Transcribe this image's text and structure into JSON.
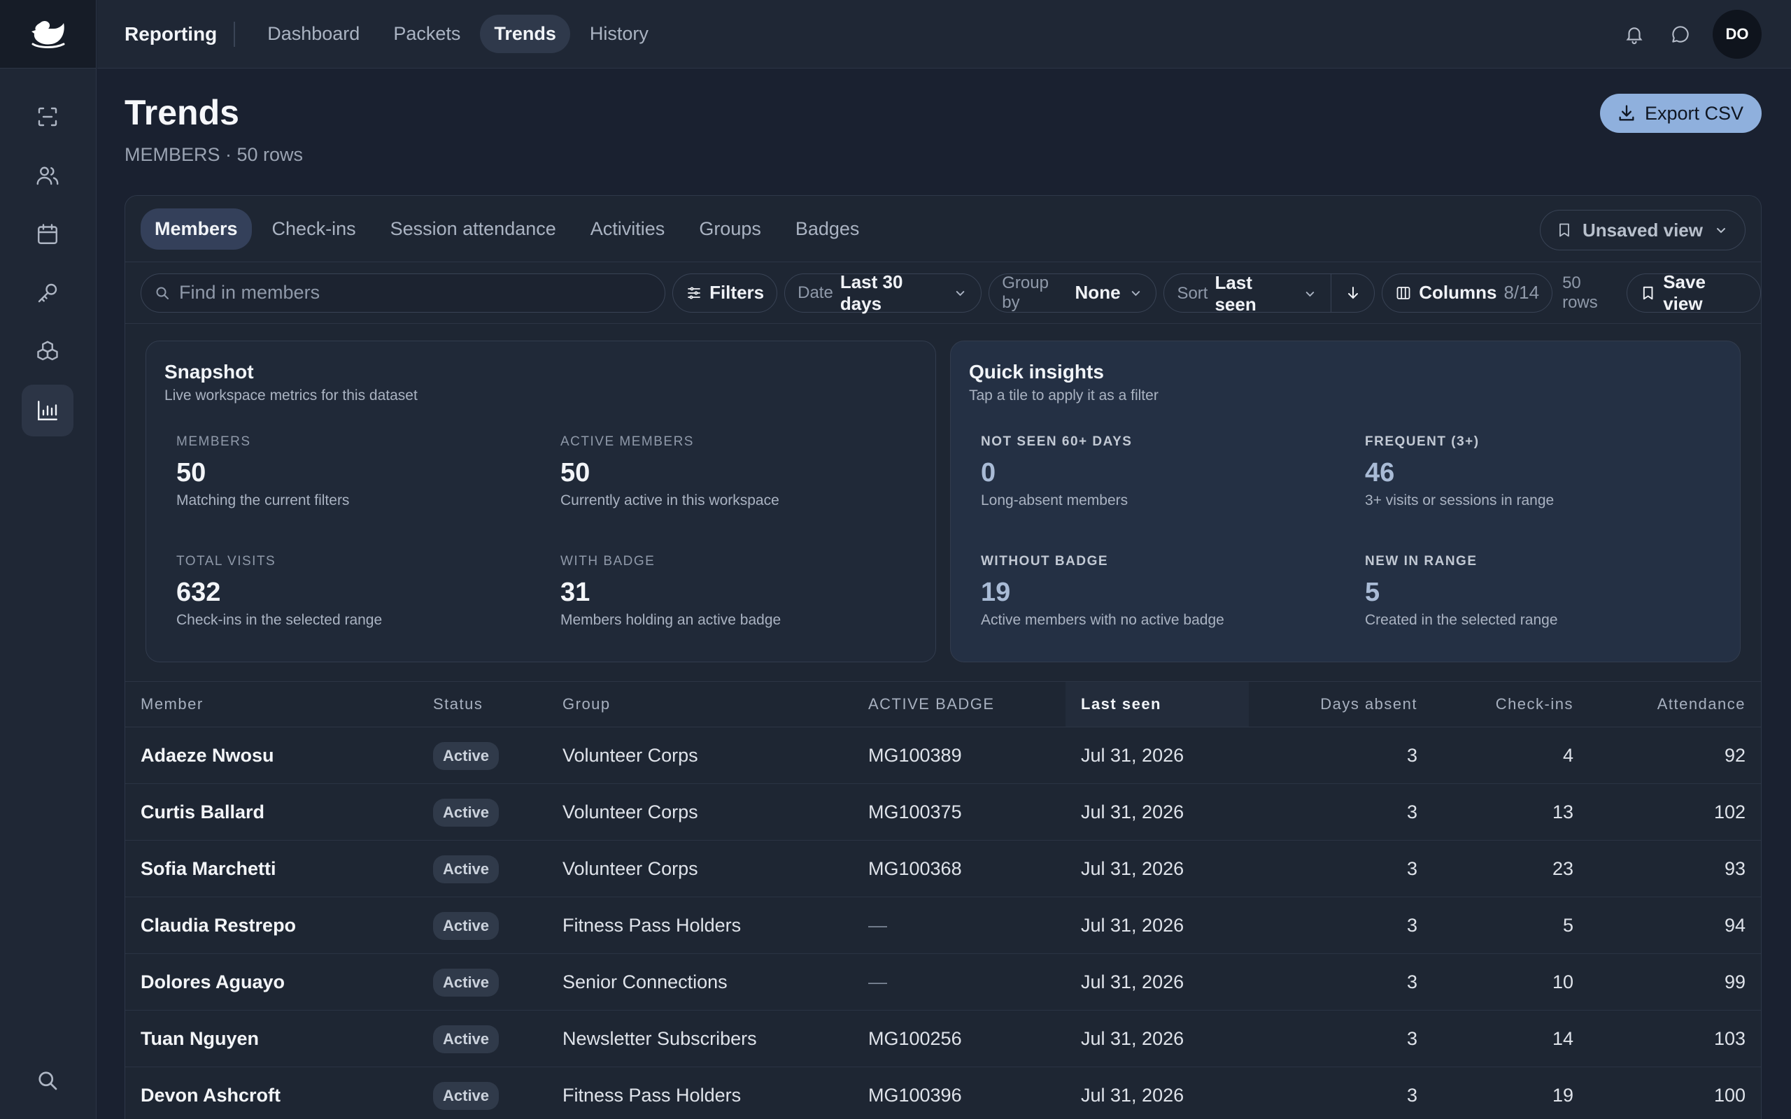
{
  "app": {
    "title": "Reporting"
  },
  "nav": [
    {
      "label": "Dashboard",
      "active": false
    },
    {
      "label": "Packets",
      "active": false
    },
    {
      "label": "Trends",
      "active": true
    },
    {
      "label": "History",
      "active": false
    }
  ],
  "user": {
    "initials": "DO"
  },
  "page": {
    "title": "Trends",
    "subtitle": "MEMBERS · 50 rows",
    "export_label": "Export CSV"
  },
  "tabs": [
    "Members",
    "Check-ins",
    "Session attendance",
    "Activities",
    "Groups",
    "Badges"
  ],
  "view": {
    "label": "Unsaved view"
  },
  "toolbar": {
    "search_placeholder": "Find in members",
    "filters_label": "Filters",
    "date_label": "Date",
    "date_value": "Last 30 days",
    "group_label": "Group by",
    "group_value": "None",
    "sort_label": "Sort",
    "sort_value": "Last seen",
    "columns_label": "Columns",
    "columns_count": "8/14",
    "rows_label": "50 rows",
    "save_label": "Save view"
  },
  "snapshot": {
    "title": "Snapshot",
    "subtitle": "Live workspace metrics for this dataset",
    "metrics": [
      {
        "label": "MEMBERS",
        "value": "50",
        "desc": "Matching the current filters"
      },
      {
        "label": "ACTIVE MEMBERS",
        "value": "50",
        "desc": "Currently active in this workspace"
      },
      {
        "label": "TOTAL VISITS",
        "value": "632",
        "desc": "Check-ins in the selected range"
      },
      {
        "label": "WITH BADGE",
        "value": "31",
        "desc": "Members holding an active badge"
      }
    ]
  },
  "insights": {
    "title": "Quick insights",
    "subtitle": "Tap a tile to apply it as a filter",
    "metrics": [
      {
        "label": "NOT SEEN 60+ DAYS",
        "value": "0",
        "desc": "Long-absent members"
      },
      {
        "label": "FREQUENT (3+)",
        "value": "46",
        "desc": "3+ visits or sessions in range"
      },
      {
        "label": "WITHOUT BADGE",
        "value": "19",
        "desc": "Active members with no active badge"
      },
      {
        "label": "NEW IN RANGE",
        "value": "5",
        "desc": "Created in the selected range"
      }
    ]
  },
  "table": {
    "columns": [
      "Member",
      "Status",
      "Group",
      "ACTIVE BADGE",
      "Last seen",
      "Days absent",
      "Check-ins",
      "Attendance"
    ],
    "rows": [
      {
        "member": "Adaeze Nwosu",
        "status": "Active",
        "group": "Volunteer Corps",
        "badge": "MG100389",
        "last_seen": "Jul 31, 2026",
        "days_absent": "3",
        "checkins": "4",
        "attendance": "92"
      },
      {
        "member": "Curtis Ballard",
        "status": "Active",
        "group": "Volunteer Corps",
        "badge": "MG100375",
        "last_seen": "Jul 31, 2026",
        "days_absent": "3",
        "checkins": "13",
        "attendance": "102"
      },
      {
        "member": "Sofia Marchetti",
        "status": "Active",
        "group": "Volunteer Corps",
        "badge": "MG100368",
        "last_seen": "Jul 31, 2026",
        "days_absent": "3",
        "checkins": "23",
        "attendance": "93"
      },
      {
        "member": "Claudia Restrepo",
        "status": "Active",
        "group": "Fitness Pass Holders",
        "badge": "—",
        "last_seen": "Jul 31, 2026",
        "days_absent": "3",
        "checkins": "5",
        "attendance": "94"
      },
      {
        "member": "Dolores Aguayo",
        "status": "Active",
        "group": "Senior Connections",
        "badge": "—",
        "last_seen": "Jul 31, 2026",
        "days_absent": "3",
        "checkins": "10",
        "attendance": "99"
      },
      {
        "member": "Tuan Nguyen",
        "status": "Active",
        "group": "Newsletter Subscribers",
        "badge": "MG100256",
        "last_seen": "Jul 31, 2026",
        "days_absent": "3",
        "checkins": "14",
        "attendance": "103"
      },
      {
        "member": "Devon Ashcroft",
        "status": "Active",
        "group": "Fitness Pass Holders",
        "badge": "MG100396",
        "last_seen": "Jul 31, 2026",
        "days_absent": "3",
        "checkins": "19",
        "attendance": "100"
      }
    ]
  }
}
